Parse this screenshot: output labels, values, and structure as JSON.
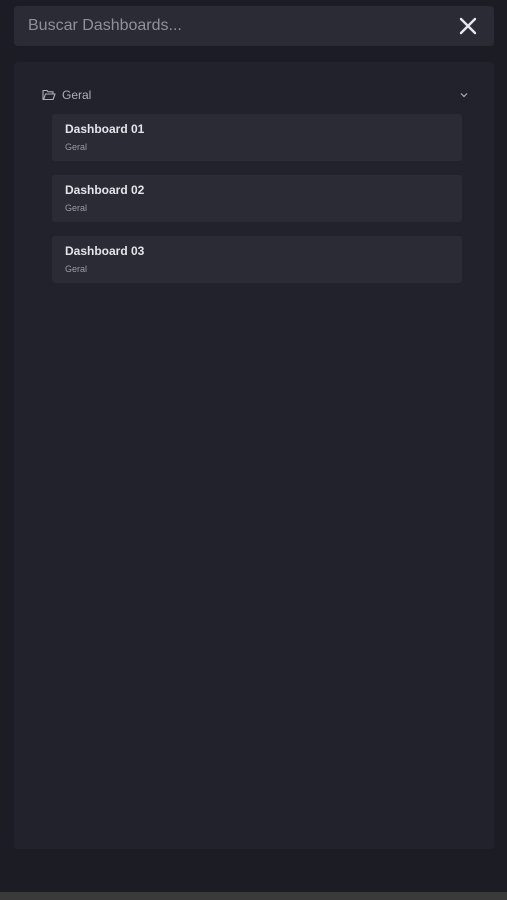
{
  "search": {
    "placeholder": "Buscar Dashboards..."
  },
  "folder": {
    "label": "Geral",
    "items": [
      {
        "title": "Dashboard 01",
        "subtitle": "Geral"
      },
      {
        "title": "Dashboard 02",
        "subtitle": "Geral"
      },
      {
        "title": "Dashboard 03",
        "subtitle": "Geral"
      }
    ]
  },
  "icons": {
    "close": "close-icon",
    "folder": "folder-open-icon",
    "chevron": "chevron-down-icon"
  },
  "colors": {
    "background": "#1b1c24",
    "panel": "#21222c",
    "card": "#2a2b35"
  }
}
